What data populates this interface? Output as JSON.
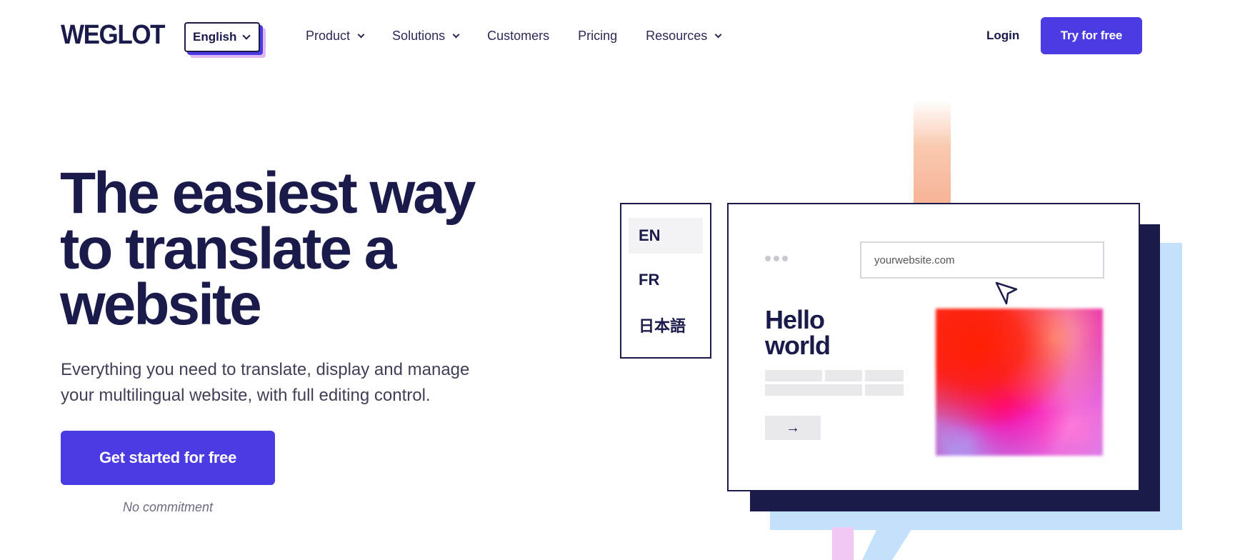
{
  "header": {
    "logo": "WEGLOT",
    "language_selector": "English",
    "nav": [
      {
        "label": "Product",
        "has_dropdown": true
      },
      {
        "label": "Solutions",
        "has_dropdown": true
      },
      {
        "label": "Customers",
        "has_dropdown": false
      },
      {
        "label": "Pricing",
        "has_dropdown": false
      },
      {
        "label": "Resources",
        "has_dropdown": true
      }
    ],
    "login": "Login",
    "try_button": "Try for free"
  },
  "hero": {
    "title": "The easiest way to translate a website",
    "subtitle": "Everything you need to translate, display and manage your multilingual website, with full editing control.",
    "cta": "Get started for free",
    "note": "No commitment"
  },
  "illustration": {
    "languages": [
      "EN",
      "FR",
      "日本語"
    ],
    "active_language": "EN",
    "url": "yourwebsite.com",
    "heading_line1": "Hello",
    "heading_line2": "world",
    "arrow": "→"
  },
  "colors": {
    "brand_primary": "#4b3be2",
    "navy": "#1a1a4b",
    "light_blue": "#c3e1fb",
    "orange_bar": "#f7b397",
    "pink_bar": "#f1c7f3"
  },
  "icons": {
    "chevron": "chevron-down-icon",
    "cursor": "cursor-arrow-icon",
    "arrow": "arrow-right-icon"
  }
}
